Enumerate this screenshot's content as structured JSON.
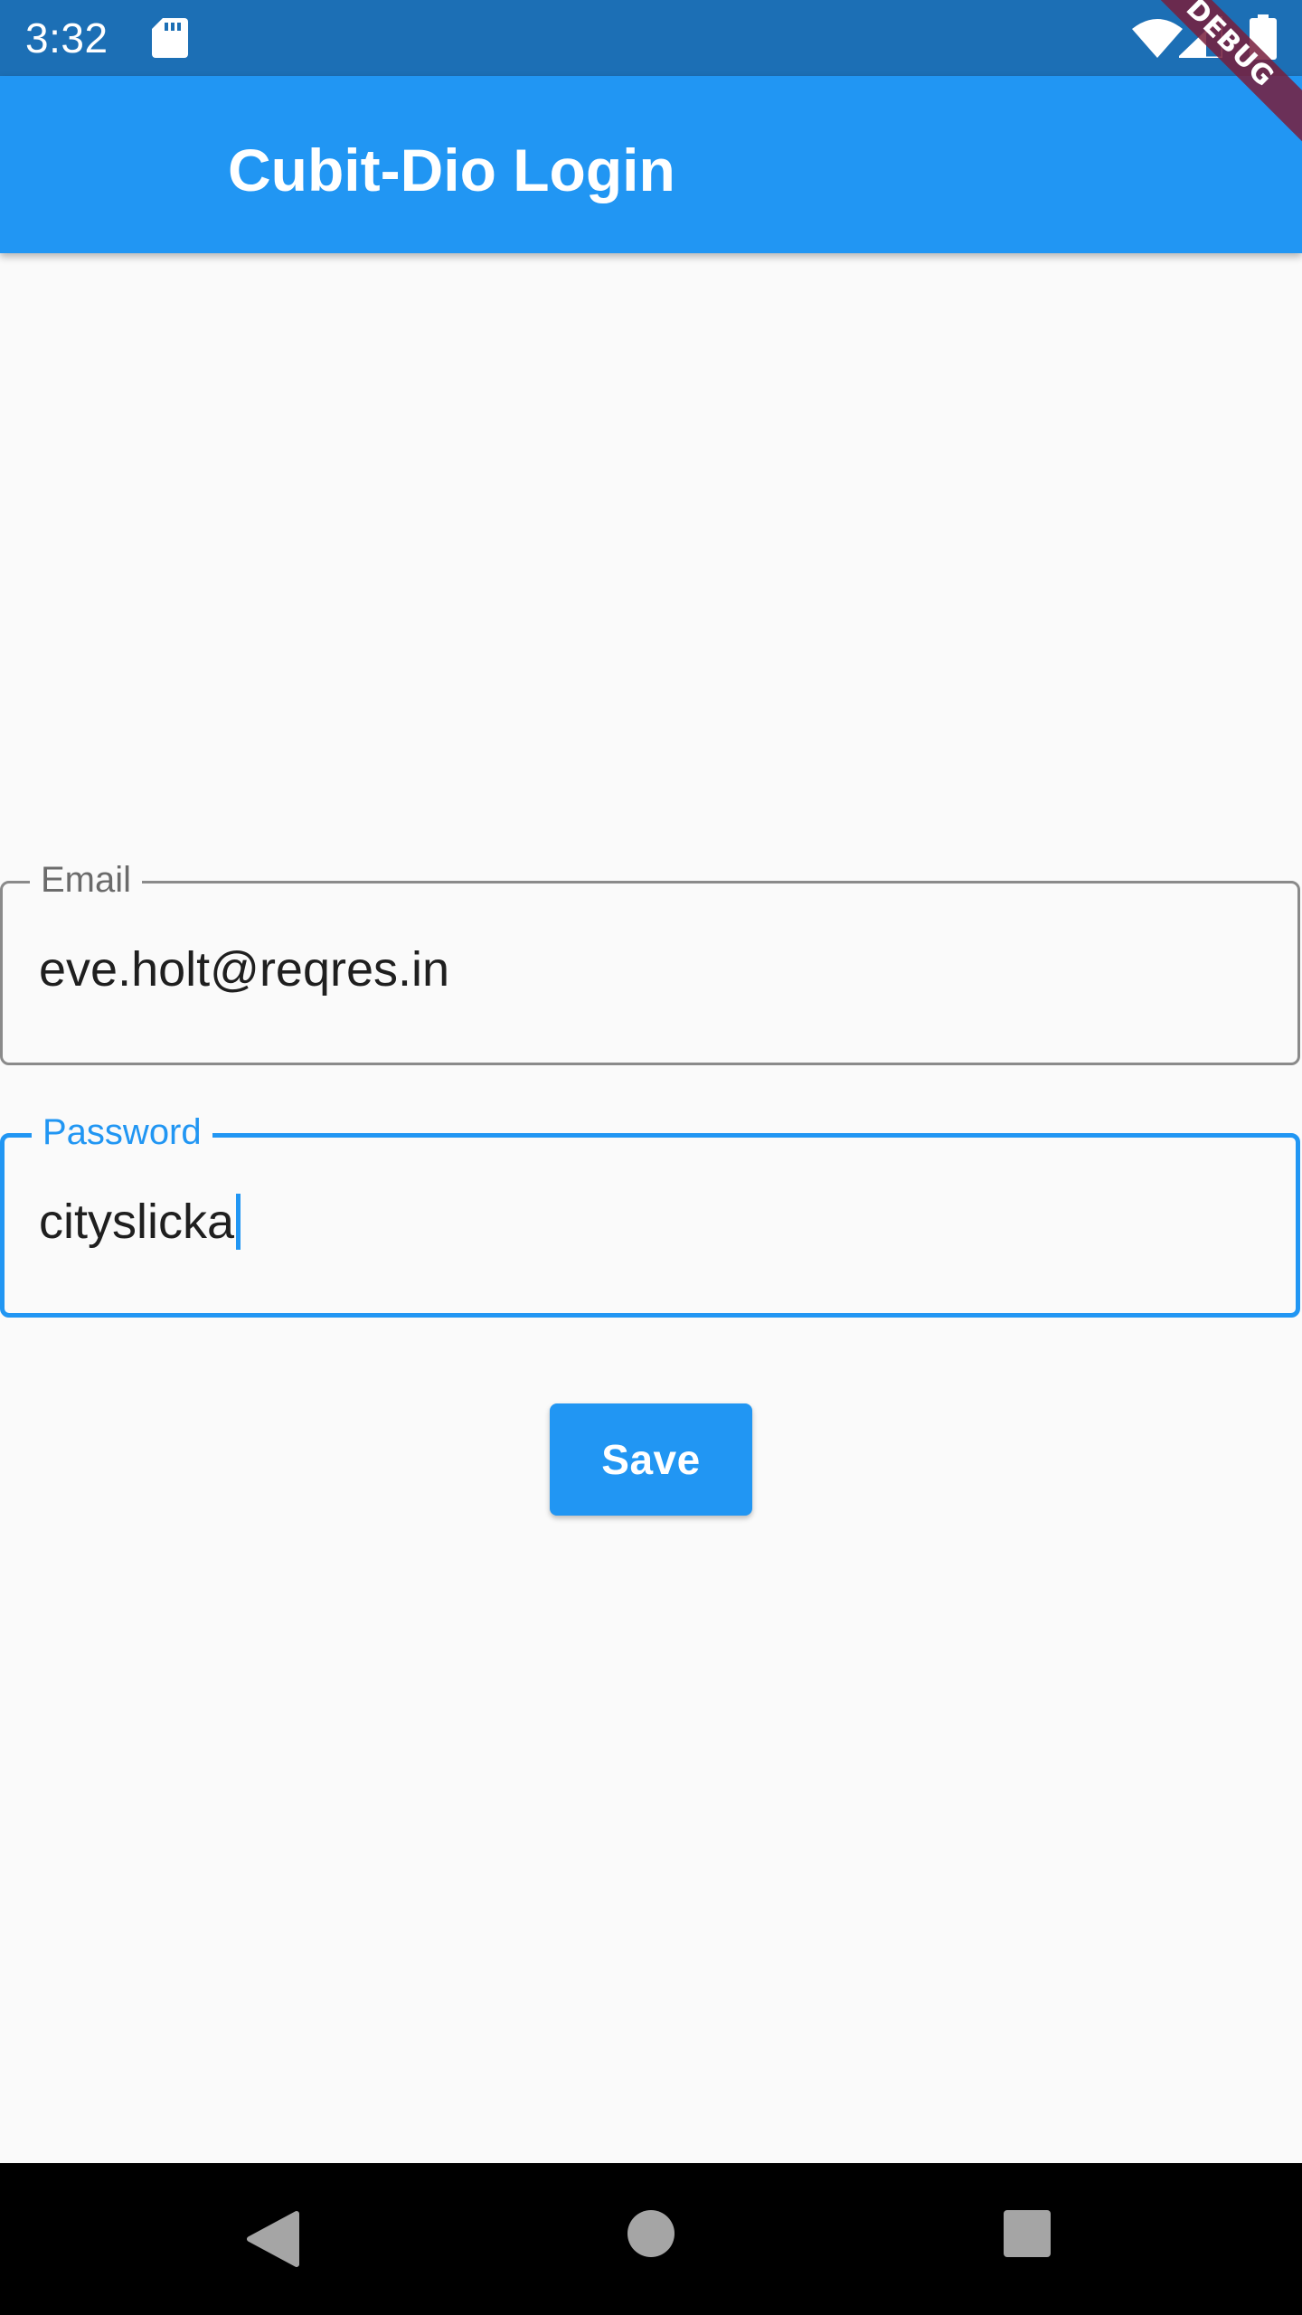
{
  "status_bar": {
    "time": "3:32",
    "icons": [
      "sd-card-icon",
      "wifi-icon",
      "signal-icon",
      "battery-icon"
    ]
  },
  "debug_banner": "DEBUG",
  "app_bar": {
    "title": "Cubit-Dio Login",
    "color": "#2196f3"
  },
  "form": {
    "email": {
      "label": "Email",
      "value": "eve.holt@reqres.in"
    },
    "password": {
      "label": "Password",
      "value": "cityslicka"
    },
    "save_label": "Save"
  },
  "nav_bar": {
    "icons": [
      "back-icon",
      "home-icon",
      "recents-icon"
    ]
  },
  "colors": {
    "status_bar": "#1c6fb5",
    "accent": "#2196f3",
    "background": "#fafafa"
  }
}
